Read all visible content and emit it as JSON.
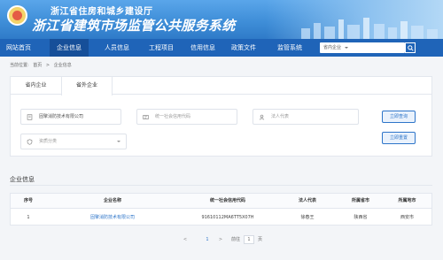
{
  "header": {
    "org_title": "浙江省住房和城乡建设厅",
    "platform_title": "浙江省建筑市场监管公共服务系统"
  },
  "nav": {
    "items": [
      "网站首页",
      "企业信息",
      "人员信息",
      "工程项目",
      "信用信息",
      "政策文件",
      "监管系统"
    ],
    "active_index": 1,
    "search_select": "省内企业"
  },
  "breadcrumb": {
    "prefix": "当前位置:",
    "items": [
      "首页",
      ">",
      "企业信息"
    ]
  },
  "search_panel": {
    "tabs": [
      "省内企业",
      "省外企业"
    ],
    "active_tab": 1,
    "company_name_value": "固擎消防技术有限公司",
    "credit_code_placeholder": "统一社会信用代码",
    "legal_rep_placeholder": "法人代表",
    "qualification_placeholder": "资质分类",
    "query_button": "立即查询",
    "reset_button": "立即重置"
  },
  "results": {
    "title": "企业信息",
    "columns": [
      "序号",
      "企业名称",
      "统一社会信用代码",
      "法人代表",
      "所属省市",
      "所属地市"
    ],
    "rows": [
      [
        "1",
        "固擎消防技术有限公司",
        "91610112MA6TT5X07H",
        "徐春王",
        "陕西省",
        "西安市"
      ]
    ]
  },
  "pagination": {
    "prev": "<",
    "current": "1",
    "next": ">",
    "goto_label": "前往",
    "page_input": "1",
    "page_suffix": "页"
  },
  "colors": {
    "nav_bg": "#1f64b8",
    "accent": "#2e75c9",
    "banner": "#3f8ed8"
  }
}
